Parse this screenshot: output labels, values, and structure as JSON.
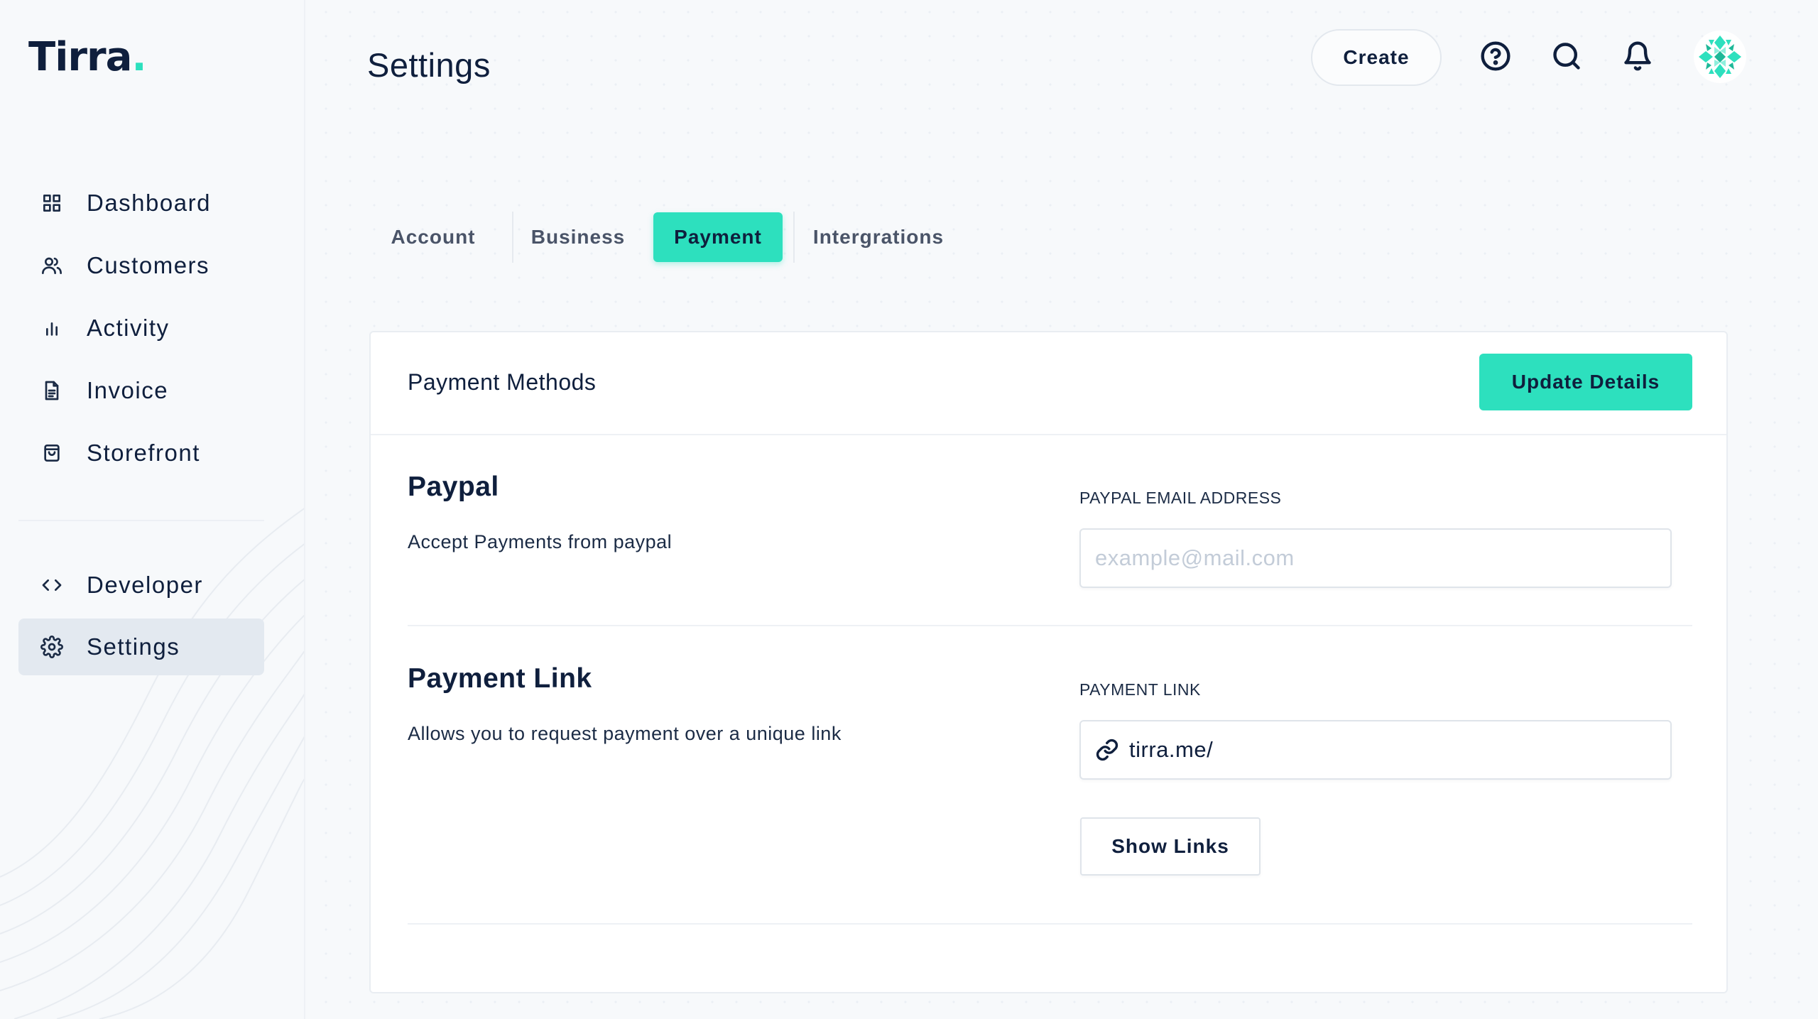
{
  "app": {
    "logo_text": "Tirra",
    "logo_dot": "."
  },
  "colors": {
    "accent": "#2de0be",
    "text": "#0f1f3d",
    "sidebar_active_bg": "#e3e9f0"
  },
  "sidebar": {
    "items": [
      {
        "label": "Dashboard",
        "icon": "grid-icon"
      },
      {
        "label": "Customers",
        "icon": "users-icon"
      },
      {
        "label": "Activity",
        "icon": "bar-chart-icon"
      },
      {
        "label": "Invoice",
        "icon": "document-icon"
      },
      {
        "label": "Storefront",
        "icon": "shopping-bag-icon"
      }
    ],
    "bottom_items": [
      {
        "label": "Developer",
        "icon": "code-icon"
      },
      {
        "label": "Settings",
        "icon": "gear-icon",
        "active": true
      }
    ]
  },
  "header": {
    "title": "Settings",
    "create_label": "Create",
    "icons": [
      "help-icon",
      "search-icon",
      "bell-icon",
      "avatar"
    ]
  },
  "tabs": [
    {
      "label": "Account",
      "active": false
    },
    {
      "label": "Business",
      "active": false
    },
    {
      "label": "Payment",
      "active": true
    },
    {
      "label": "Intergrations",
      "active": false
    }
  ],
  "card": {
    "title": "Payment Methods",
    "update_button": "Update Details",
    "paypal": {
      "title": "Paypal",
      "description": "Accept Payments from paypal",
      "field_label": "PAYPAL EMAIL ADDRESS",
      "placeholder": "example@mail.com"
    },
    "payment_link": {
      "title": "Payment Link",
      "description": "Allows you to request payment over a unique link",
      "field_label": "PAYMENT LINK",
      "value": "tirra.me/",
      "show_links_button": "Show Links"
    }
  }
}
